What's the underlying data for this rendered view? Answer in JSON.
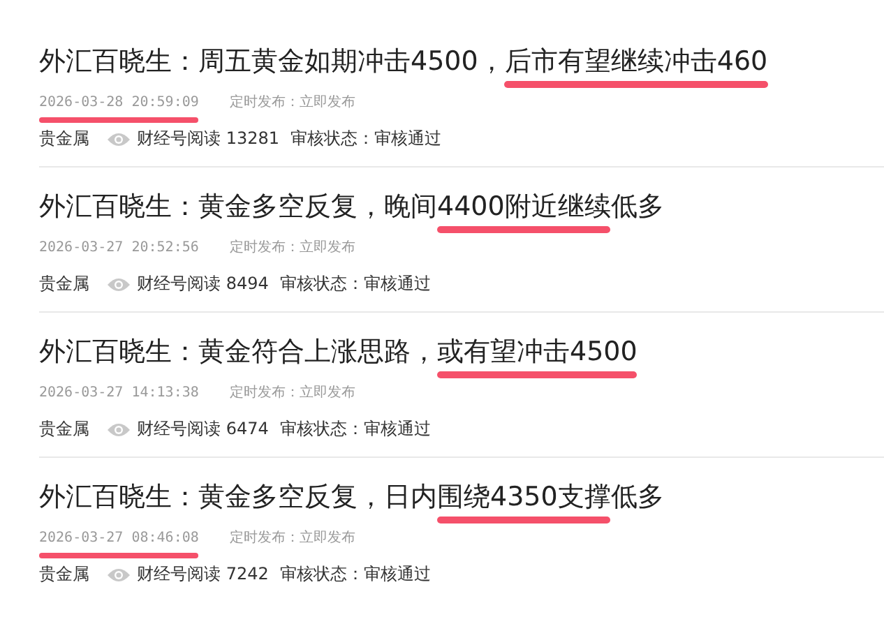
{
  "articles": [
    {
      "title_parts": [
        {
          "text": "外汇百晓生：周五黄金如期冲击4500，",
          "underlined": false
        },
        {
          "text": "后市有望继续冲击460",
          "underlined": true
        }
      ],
      "date": "2026-03-28 20:59:09",
      "date_underlined": true,
      "publish": "定时发布：立即发布",
      "category": "贵金属",
      "reads": "财经号阅读 13281",
      "status": "审核状态：审核通过"
    },
    {
      "title_parts": [
        {
          "text": "外汇百晓生：黄金多空反复，晚间",
          "underlined": false
        },
        {
          "text": "4400附近继续",
          "underlined": true
        },
        {
          "text": "低多",
          "underlined": false
        }
      ],
      "date": "2026-03-27 20:52:56",
      "date_underlined": false,
      "publish": "定时发布：立即发布",
      "category": "贵金属",
      "reads": "财经号阅读 8494",
      "status": "审核状态：审核通过"
    },
    {
      "title_parts": [
        {
          "text": "外汇百晓生：黄金符合上涨思路，",
          "underlined": false
        },
        {
          "text": "或有望冲击4500",
          "underlined": true
        }
      ],
      "date": "2026-03-27 14:13:38",
      "date_underlined": false,
      "publish": "定时发布：立即发布",
      "category": "贵金属",
      "reads": "财经号阅读 6474",
      "status": "审核状态：审核通过"
    },
    {
      "title_parts": [
        {
          "text": "外汇百晓生：黄金多空反复，日内",
          "underlined": false
        },
        {
          "text": "围绕4350支撑",
          "underlined": true
        },
        {
          "text": "低多",
          "underlined": false
        }
      ],
      "date": "2026-03-27 08:46:08",
      "date_underlined": true,
      "publish": "定时发布：立即发布",
      "category": "贵金属",
      "reads": "财经号阅读 7242",
      "status": "审核状态：审核通过"
    }
  ]
}
